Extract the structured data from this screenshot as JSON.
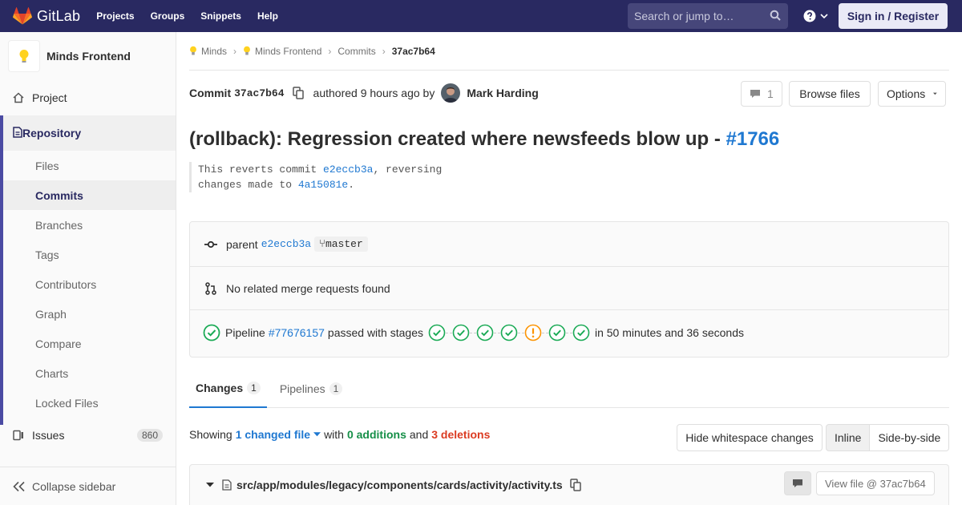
{
  "topnav": {
    "brand": "GitLab",
    "links": [
      "Projects",
      "Groups",
      "Snippets",
      "Help"
    ],
    "search_placeholder": "Search or jump to…",
    "signin": "Sign in / Register",
    "brand_color": "#292961"
  },
  "sidebar": {
    "project_name": "Minds Frontend",
    "project": "Project",
    "repository": "Repository",
    "repo_items": [
      "Files",
      "Commits",
      "Branches",
      "Tags",
      "Contributors",
      "Graph",
      "Compare",
      "Charts",
      "Locked Files"
    ],
    "active_item": "Commits",
    "issues": "Issues",
    "issues_count": "860",
    "collapse": "Collapse sidebar"
  },
  "breadcrumbs": [
    "Minds",
    "Minds Frontend",
    "Commits",
    "37ac7b64"
  ],
  "commit": {
    "label": "Commit",
    "sha": "37ac7b64",
    "authored": "authored 9 hours ago by",
    "author": "Mark Harding",
    "comments_count": "1",
    "browse_files": "Browse files",
    "options": "Options",
    "title_text": "(rollback): Regression created where newsfeeds blow up - ",
    "title_issue": "#1766",
    "desc_line1_a": "This reverts commit ",
    "desc_line1_link": "e2eccb3a",
    "desc_line1_b": ", reversing",
    "desc_line2_a": "changes made to ",
    "desc_line2_link": "4a15081e",
    "desc_line2_b": "."
  },
  "info": {
    "parent_label": "parent",
    "parent_sha": "e2eccb3a",
    "branch": "master",
    "mr_text": "No related merge requests found",
    "pipeline_label": "Pipeline",
    "pipeline_id": "#77676157",
    "pipeline_passed": "passed with stages",
    "pipeline_duration": "in 50 minutes and 36 seconds",
    "stage_statuses": [
      "success",
      "success",
      "success",
      "success",
      "warning",
      "success",
      "success"
    ],
    "success_color": "#1aaa55",
    "warning_color": "#fc9403"
  },
  "tabs": [
    {
      "label": "Changes",
      "count": "1"
    },
    {
      "label": "Pipelines",
      "count": "1"
    }
  ],
  "diff": {
    "showing": "Showing",
    "changed_file": "1 changed file",
    "with": "with",
    "additions": "0 additions",
    "and": "and",
    "deletions": "3 deletions",
    "hide_ws": "Hide whitespace changes",
    "inline": "Inline",
    "side_by_side": "Side-by-side",
    "file_path": "src/app/modules/legacy/components/cards/activity/activity.ts",
    "view_file": "View file @ 37ac7b64"
  }
}
